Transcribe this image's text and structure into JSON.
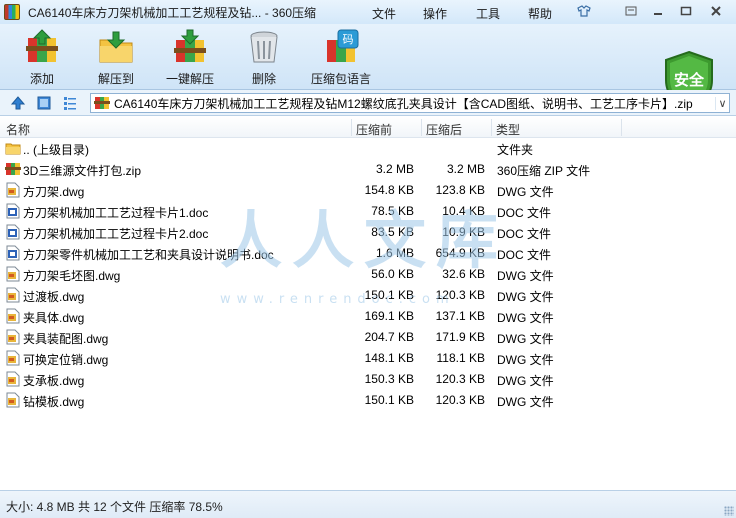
{
  "window": {
    "title": "CA6140车床方刀架机械加工工艺规程及钻...  - 360压缩",
    "menu": [
      "文件",
      "操作",
      "工具",
      "帮助"
    ]
  },
  "toolbar": {
    "buttons": [
      {
        "label": "添加",
        "icon": "add-archive-icon"
      },
      {
        "label": "解压到",
        "icon": "extract-to-icon"
      },
      {
        "label": "一键解压",
        "icon": "one-click-extract-icon"
      },
      {
        "label": "删除",
        "icon": "trash-icon"
      },
      {
        "label": "压缩包语言",
        "icon": "archive-language-icon"
      }
    ],
    "security_badge": "安全",
    "colors": {
      "badge": "#3d9a2f"
    }
  },
  "address": {
    "path": "CA6140车床方刀架机械加工工艺规程及钻M12螺纹底孔夹具设计【含CAD图纸、说明书、工艺工序卡片】.zip"
  },
  "columns": {
    "name": "名称",
    "packed": "压缩前",
    "compressed": "压缩后",
    "type": "类型"
  },
  "files": [
    {
      "name": ".. (上级目录)",
      "packed": "",
      "compressed": "",
      "type": "文件夹",
      "icon": "folder-up-icon"
    },
    {
      "name": "3D三维源文件打包.zip",
      "packed": "3.2 MB",
      "compressed": "3.2 MB",
      "type": "360压缩 ZIP 文件",
      "icon": "zip-icon"
    },
    {
      "name": "方刀架.dwg",
      "packed": "154.8 KB",
      "compressed": "123.8 KB",
      "type": "DWG 文件",
      "icon": "dwg-icon"
    },
    {
      "name": "方刀架机械加工工艺过程卡片1.doc",
      "packed": "78.5 KB",
      "compressed": "10.4 KB",
      "type": "DOC 文件",
      "icon": "doc-icon"
    },
    {
      "name": "方刀架机械加工工艺过程卡片2.doc",
      "packed": "83.5 KB",
      "compressed": "10.9 KB",
      "type": "DOC 文件",
      "icon": "doc-icon"
    },
    {
      "name": "方刀架零件机械加工工艺和夹具设计说明书.doc",
      "packed": "1.6 MB",
      "compressed": "654.9 KB",
      "type": "DOC 文件",
      "icon": "doc-icon"
    },
    {
      "name": "方刀架毛坯图.dwg",
      "packed": "56.0 KB",
      "compressed": "32.6 KB",
      "type": "DWG 文件",
      "icon": "dwg-icon"
    },
    {
      "name": "过渡板.dwg",
      "packed": "150.1 KB",
      "compressed": "120.3 KB",
      "type": "DWG 文件",
      "icon": "dwg-icon"
    },
    {
      "name": "夹具体.dwg",
      "packed": "169.1 KB",
      "compressed": "137.1 KB",
      "type": "DWG 文件",
      "icon": "dwg-icon"
    },
    {
      "name": "夹具装配图.dwg",
      "packed": "204.7 KB",
      "compressed": "171.9 KB",
      "type": "DWG 文件",
      "icon": "dwg-icon"
    },
    {
      "name": "可换定位销.dwg",
      "packed": "148.1 KB",
      "compressed": "118.1 KB",
      "type": "DWG 文件",
      "icon": "dwg-icon"
    },
    {
      "name": "支承板.dwg",
      "packed": "150.3 KB",
      "compressed": "120.3 KB",
      "type": "DWG 文件",
      "icon": "dwg-icon"
    },
    {
      "name": "钻模板.dwg",
      "packed": "150.1 KB",
      "compressed": "120.3 KB",
      "type": "DWG 文件",
      "icon": "dwg-icon"
    }
  ],
  "watermark": {
    "text": "人人文库",
    "url": "www.renrendoc.com"
  },
  "status": {
    "text": "大小: 4.8 MB 共 12 个文件 压缩率 78.5%"
  }
}
